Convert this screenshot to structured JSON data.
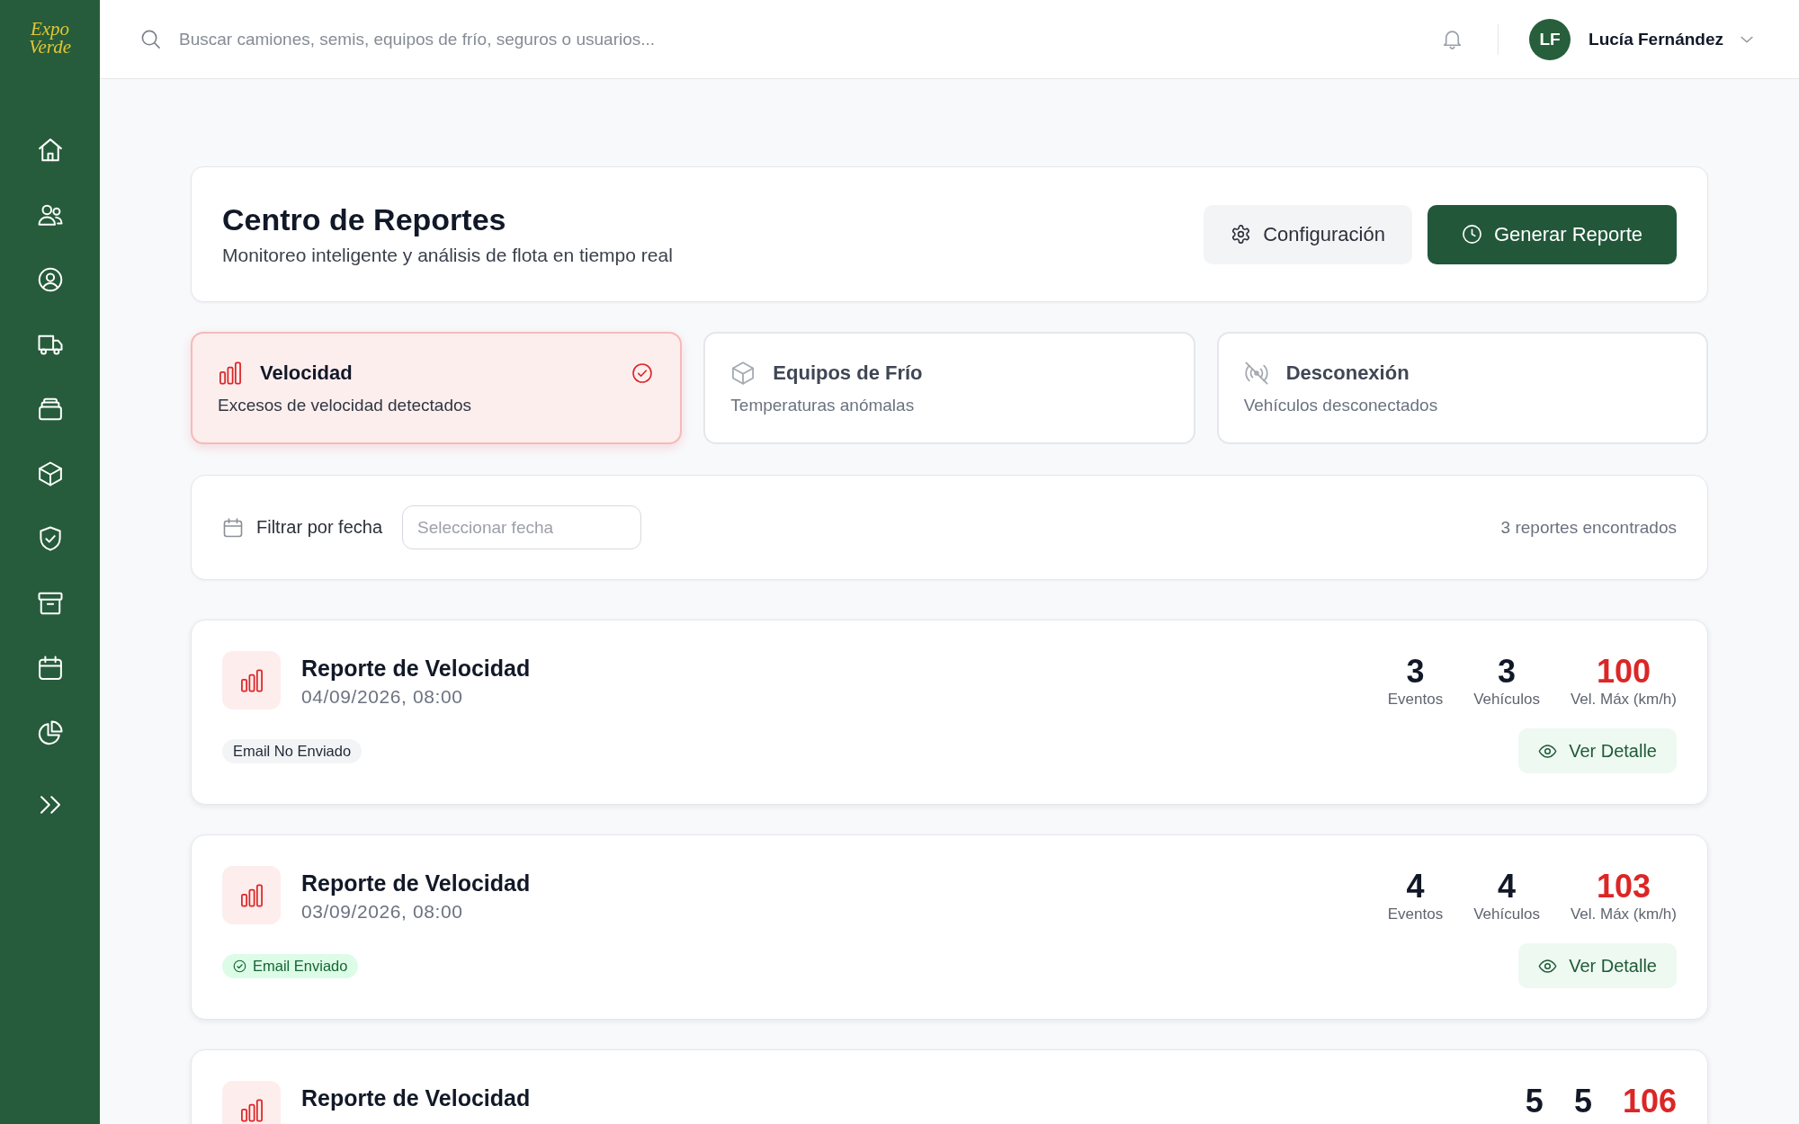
{
  "sidebar": {
    "logo": "Expo Verde",
    "items": [
      {
        "kind": "home",
        "selected": false
      },
      {
        "kind": "users",
        "selected": false
      },
      {
        "kind": "profile",
        "selected": false
      },
      {
        "kind": "truck",
        "selected": false
      },
      {
        "kind": "trays",
        "selected": false
      },
      {
        "kind": "cube",
        "selected": false
      },
      {
        "kind": "shield",
        "selected": false
      },
      {
        "kind": "archive",
        "selected": false
      },
      {
        "kind": "calendar",
        "selected": false
      },
      {
        "kind": "pie",
        "selected": false
      },
      {
        "kind": "expand",
        "selected": false
      }
    ]
  },
  "topbar": {
    "search": {
      "placeholder": "Buscar camiones, semis, equipos de frío, seguros o usuarios..."
    },
    "user": {
      "initials": "LF",
      "name": "Lucía Fernández"
    }
  },
  "header": {
    "title": "Centro de Reportes",
    "subtitle": "Monitoreo inteligente y análisis de flota en tiempo real",
    "buttons": [
      {
        "kind": "settings",
        "label": "Configuración"
      },
      {
        "kind": "generate",
        "label": "Generar Reporte"
      }
    ]
  },
  "report_types": [
    {
      "kind": "speed",
      "title": "Velocidad",
      "description": "Excesos de velocidad detectados",
      "selected": true
    },
    {
      "kind": "cold",
      "title": "Equipos de Frío",
      "description": "Temperaturas anómalas",
      "selected": false
    },
    {
      "kind": "disconnect",
      "title": "Desconexión",
      "description": "Vehículos desconectados",
      "selected": false
    }
  ],
  "filter": {
    "label": "Filtrar por fecha",
    "date_field": {
      "placeholder": "Seleccionar fecha"
    },
    "result_count": "3 reportes encontrados"
  },
  "reports": [
    {
      "title": "Reporte de Velocidad",
      "date": "04/09/2026, 08:00",
      "stats": [
        {
          "kind": "count",
          "value": "3",
          "label": "Eventos"
        },
        {
          "kind": "count",
          "value": "3",
          "label": "Vehículos"
        },
        {
          "kind": "speed",
          "value": "100",
          "label": "Vel. Máx (km/h)"
        }
      ],
      "email_status": {
        "label": "Email No Enviado",
        "sent": false
      },
      "action": "Ver Detalle"
    },
    {
      "title": "Reporte de Velocidad",
      "date": "03/09/2026, 08:00",
      "stats": [
        {
          "kind": "count",
          "value": "4",
          "label": "Eventos"
        },
        {
          "kind": "count",
          "value": "4",
          "label": "Vehículos"
        },
        {
          "kind": "speed",
          "value": "103",
          "label": "Vel. Máx (km/h)"
        }
      ],
      "email_status": {
        "label": "Email Enviado",
        "sent": true
      },
      "action": "Ver Detalle"
    },
    {
      "title": "Reporte de Velocidad",
      "stats": [
        {
          "kind": "count",
          "value": "5"
        },
        {
          "kind": "count",
          "value": "5"
        },
        {
          "kind": "speed",
          "value": "106"
        }
      ]
    }
  ]
}
